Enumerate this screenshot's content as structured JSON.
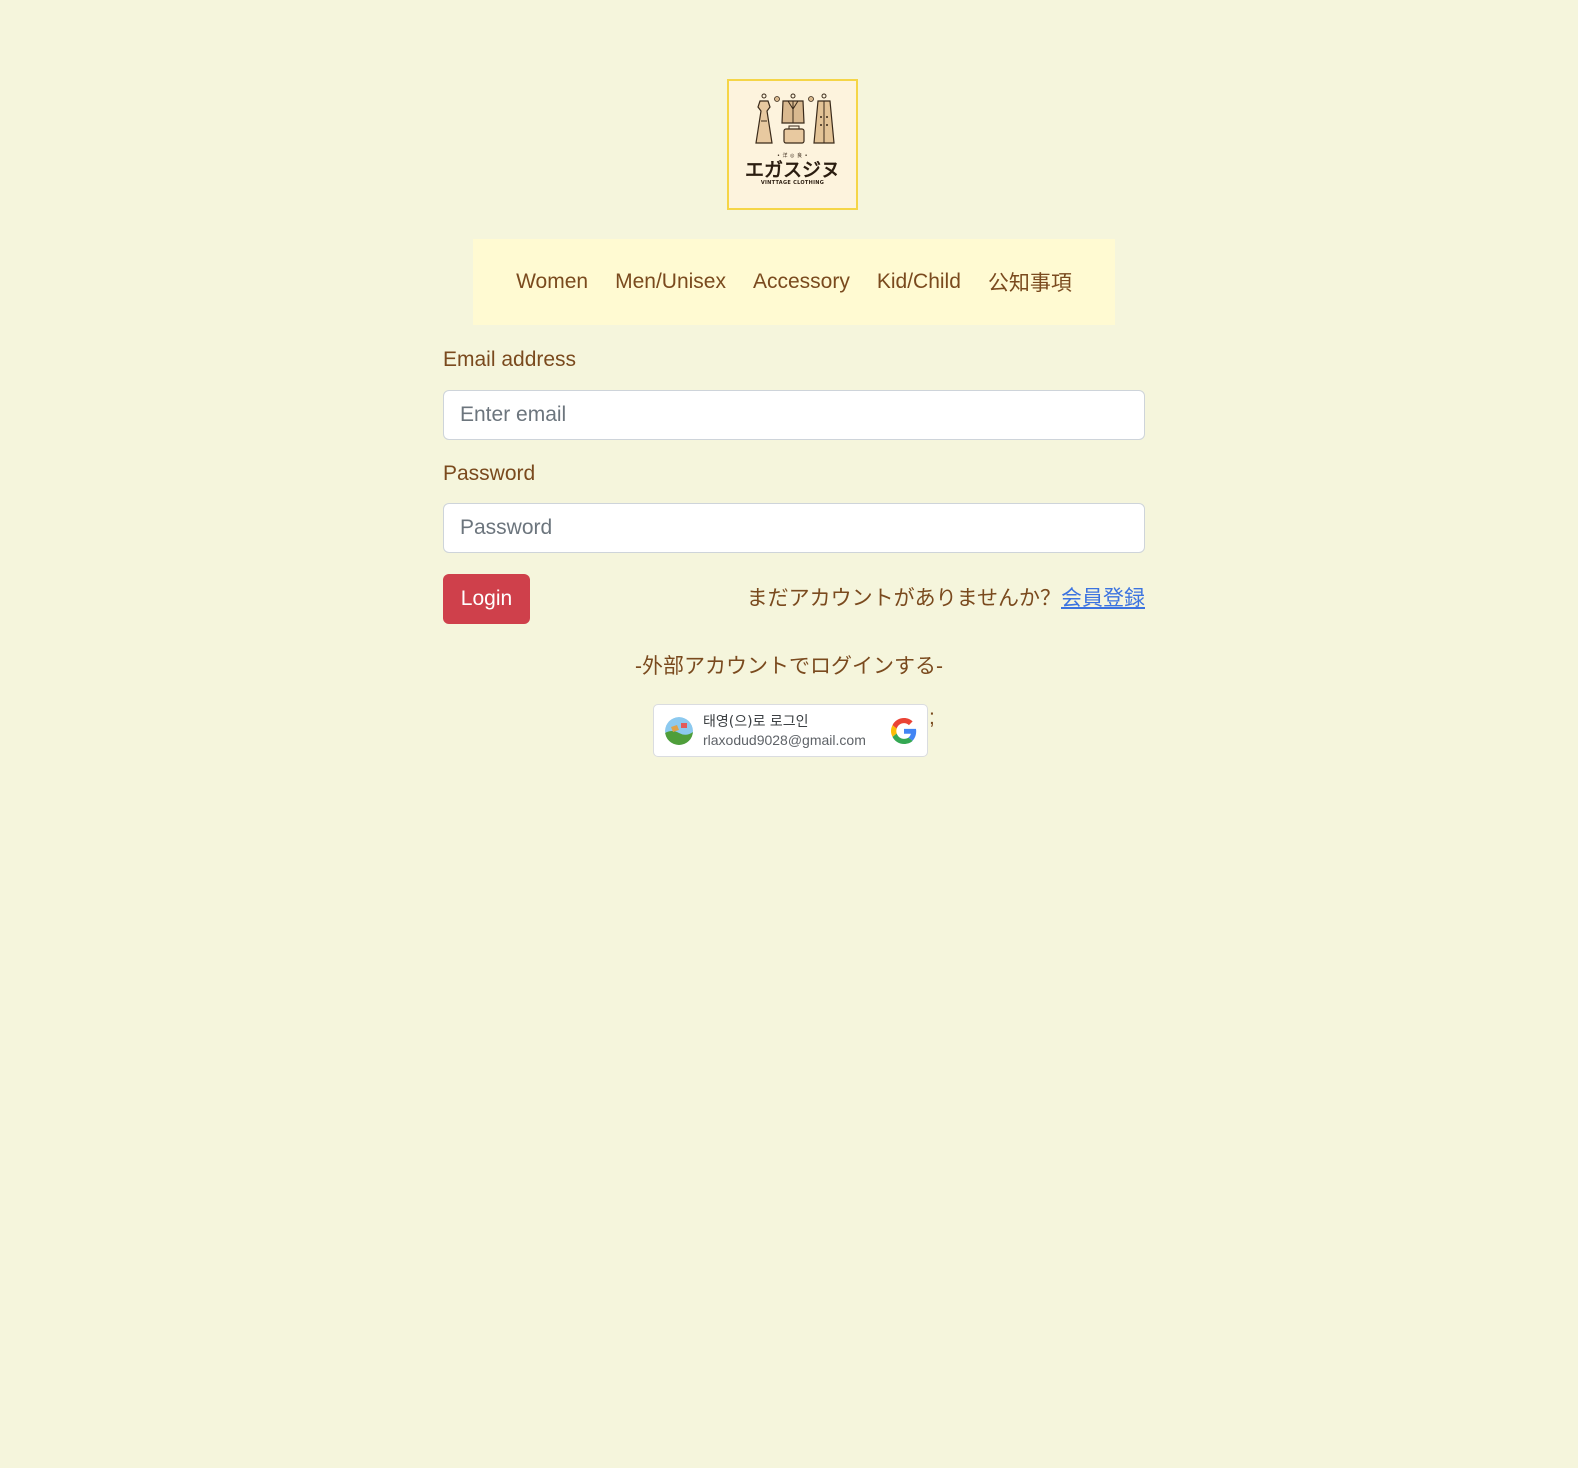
{
  "logo": {
    "subtitle": "• 洋 ◎ 良 •",
    "brand": "エガスジヌ",
    "tagline": "VINTTAGE CLOTHING"
  },
  "nav": {
    "items": [
      "Women",
      "Men/Unisex",
      "Accessory",
      "Kid/Child",
      "公知事項"
    ]
  },
  "form": {
    "email_label": "Email address",
    "email_placeholder": "Enter email",
    "email_value": "",
    "password_label": "Password",
    "password_placeholder": "Password",
    "password_value": "",
    "login_label": "Login",
    "signup_prompt": "まだアカウントがありませんか？",
    "signup_link": "会員登録"
  },
  "external": {
    "heading": "-外部アカウントでログインする-",
    "google_button": {
      "name": "태영(으)로 로그인",
      "email": "rlaxodud9028@gmail.com"
    },
    "trailing_text": ";"
  },
  "colors": {
    "background": "#f5f5dc",
    "nav_background": "#fffad2",
    "text_brown": "#7a4a1e",
    "login_button": "#cf404b",
    "link_blue": "#3b73e0",
    "logo_border": "#f5d547"
  },
  "icons": {
    "google": "google-g-icon",
    "avatar": "user-avatar"
  }
}
